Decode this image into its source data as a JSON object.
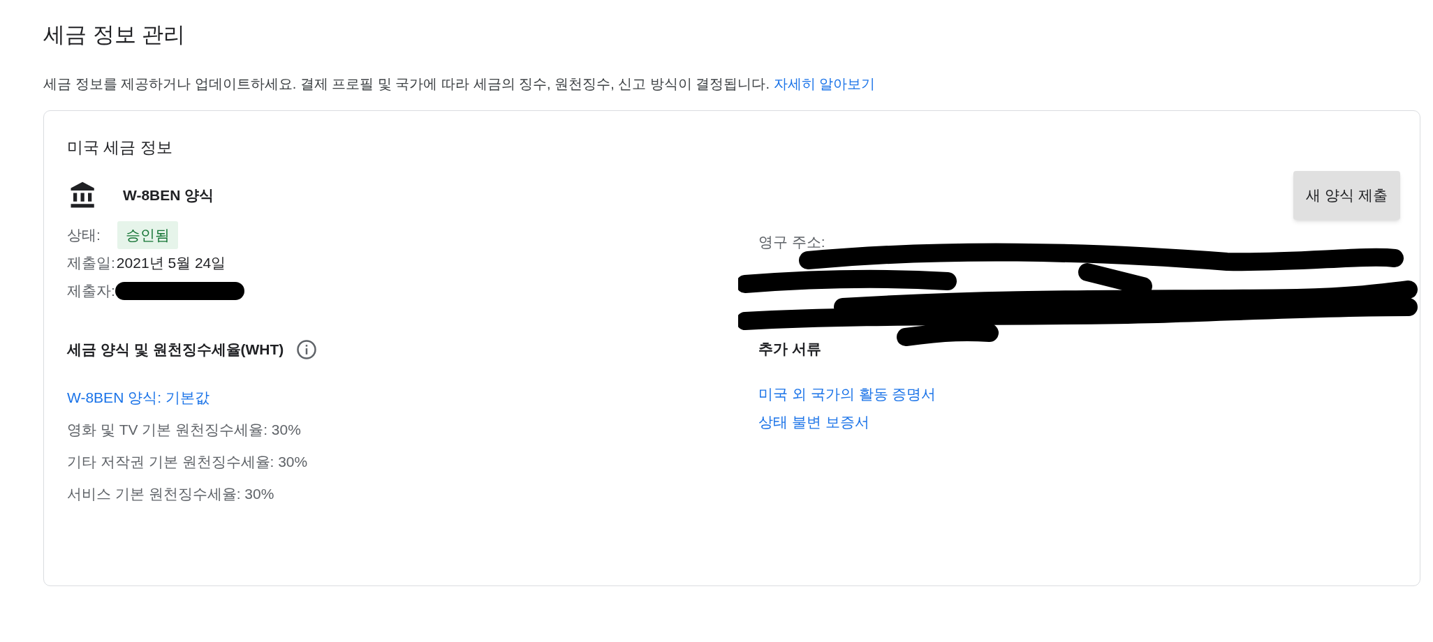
{
  "page": {
    "title": "세금 정보 관리",
    "description": "세금 정보를 제공하거나 업데이트하세요. 결제 프로필 및 국가에 따라 세금의 징수, 원천징수, 신고 방식이 결정됩니다.",
    "learn_more_link": "자세히 알아보기"
  },
  "card": {
    "title": "미국 세금 정보",
    "form_name": "W-8BEN 양식",
    "submit_button": "새 양식 제출",
    "details": [
      {
        "label": "상태:",
        "value": "승인됨",
        "kind": "badge"
      },
      {
        "label": "제출일:",
        "value": "2021년 5월 24일",
        "kind": "text"
      },
      {
        "label": "제출자:",
        "kind": "redacted"
      }
    ],
    "address_labels": [
      "영구 주소:"
    ],
    "wht": {
      "heading": "세금 양식 및 원천징수세율(WHT)",
      "link": "W-8BEN 양식: 기본값",
      "rates": [
        "영화 및 TV 기본 원천징수세율: 30%",
        "기타 저작권 기본 원천징수세율: 30%",
        "서비스 기본 원천징수세율: 30%"
      ]
    },
    "documents": {
      "heading": "추가 서류",
      "links": [
        "미국 외 국가의 활동 증명서",
        "상태 불변 보증서"
      ]
    }
  }
}
